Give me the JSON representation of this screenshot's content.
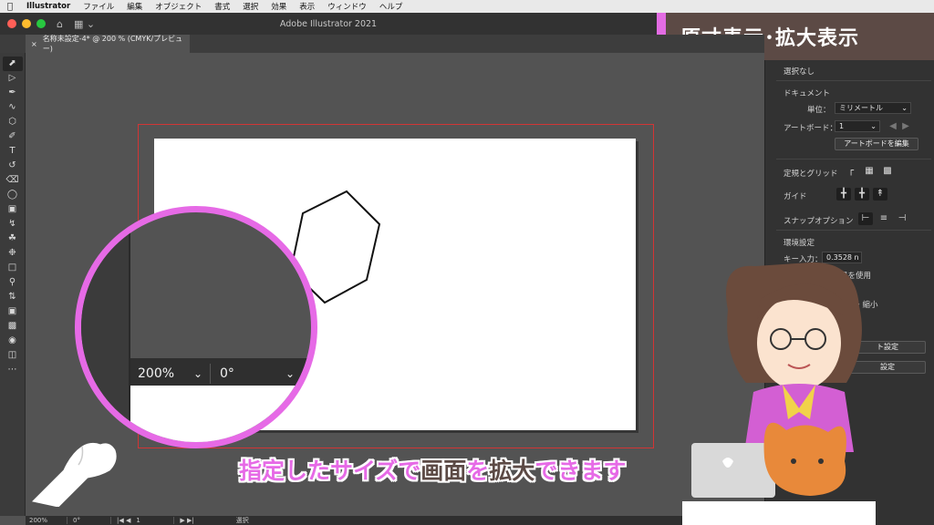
{
  "menubar": {
    "app": "Illustrator",
    "items": [
      "ファイル",
      "編集",
      "オブジェクト",
      "書式",
      "選択",
      "効果",
      "表示",
      "ウィンドウ",
      "ヘルプ"
    ]
  },
  "window": {
    "title": "Adobe Illustrator 2021"
  },
  "document_tab": {
    "label": "名称未設定-4* @ 200 % (CMYK/プレビュー)"
  },
  "caption": {
    "text": "原寸表示･拡大表示"
  },
  "properties_panel": {
    "selection": "選択なし",
    "document_heading": "ドキュメント",
    "units_label": "単位：",
    "units_value": "ミリメートル",
    "artboard_label": "アートボード：",
    "artboard_value": "1",
    "edit_artboard_button": "アートボードを編集",
    "rulers_grids_label": "定規とグリッド",
    "guides_label": "ガイド",
    "snap_label": "スナップオプション",
    "preferences_heading": "環境設定",
    "keyboard_increment_label": "キー入力：",
    "keyboard_increment_value": "0.3528 n",
    "use_preview_bounds_text": "界を使用",
    "scale_text": "・縮小",
    "document_setup_button": "ト設定",
    "preferences_button": "設定"
  },
  "magnifier": {
    "zoom_value": "200%",
    "rotation_value": "0°"
  },
  "statusbar": {
    "zoom": "200%",
    "rotation": "0°",
    "artboard": "1",
    "tool": "選択"
  },
  "subtitle": {
    "part1": "指定したサイズで",
    "part2": "画面",
    "part3": "を",
    "part4": "拡大",
    "part5": "できます"
  },
  "colors": {
    "accent_pink": "#e66ae6",
    "caption_bg": "#5c4a45",
    "bleed_red": "#d23535"
  }
}
